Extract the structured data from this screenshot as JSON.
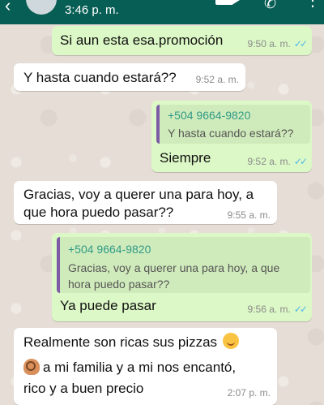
{
  "header": {
    "last_seen": "3:46 p. m.",
    "icons": [
      "back-arrow-icon",
      "video-call-icon",
      "phone-icon",
      "menu-icon"
    ]
  },
  "colors": {
    "header": "#075e54",
    "outgoing_bubble": "#dcf8c6",
    "incoming_bubble": "#ffffff",
    "read_ticks": "#4fb6ec",
    "quote_author": "#2f9a87",
    "quote_bar": "#7d5ba6"
  },
  "messages": [
    {
      "direction": "out",
      "text": "Si aun esta esa.promoción",
      "time": "9:50 a. m.",
      "ticks": "✓✓"
    },
    {
      "direction": "in",
      "text": "Y hasta cuando estará??",
      "time": "9:52 a. m."
    },
    {
      "direction": "out",
      "quote": {
        "author": "+504 9664-9820",
        "text": "Y hasta cuando estará??"
      },
      "text": "Siempre",
      "time": "9:52 a. m.",
      "ticks": "✓✓"
    },
    {
      "direction": "in",
      "text_lines": [
        "Gracias, voy a querer una para hoy, a",
        "que hora puedo pasar??"
      ],
      "time": "9:55 a. m."
    },
    {
      "direction": "out",
      "quote": {
        "author": "+504 9664-9820",
        "text_lines": [
          "Gracias, voy a querer una para hoy, a que",
          "hora puedo pasar??"
        ]
      },
      "text": "Ya puede pasar",
      "time": "9:56 a. m.",
      "ticks": "✓✓"
    },
    {
      "direction": "in",
      "text_lines": [
        "Realmente son ricas sus pizzas",
        "a mi familia y a mi nos encantó,",
        "rico y a buen precio"
      ],
      "emojis": [
        "smiling-face-emoji",
        "ok-hand-emoji"
      ],
      "time": "2:07 p. m."
    }
  ]
}
